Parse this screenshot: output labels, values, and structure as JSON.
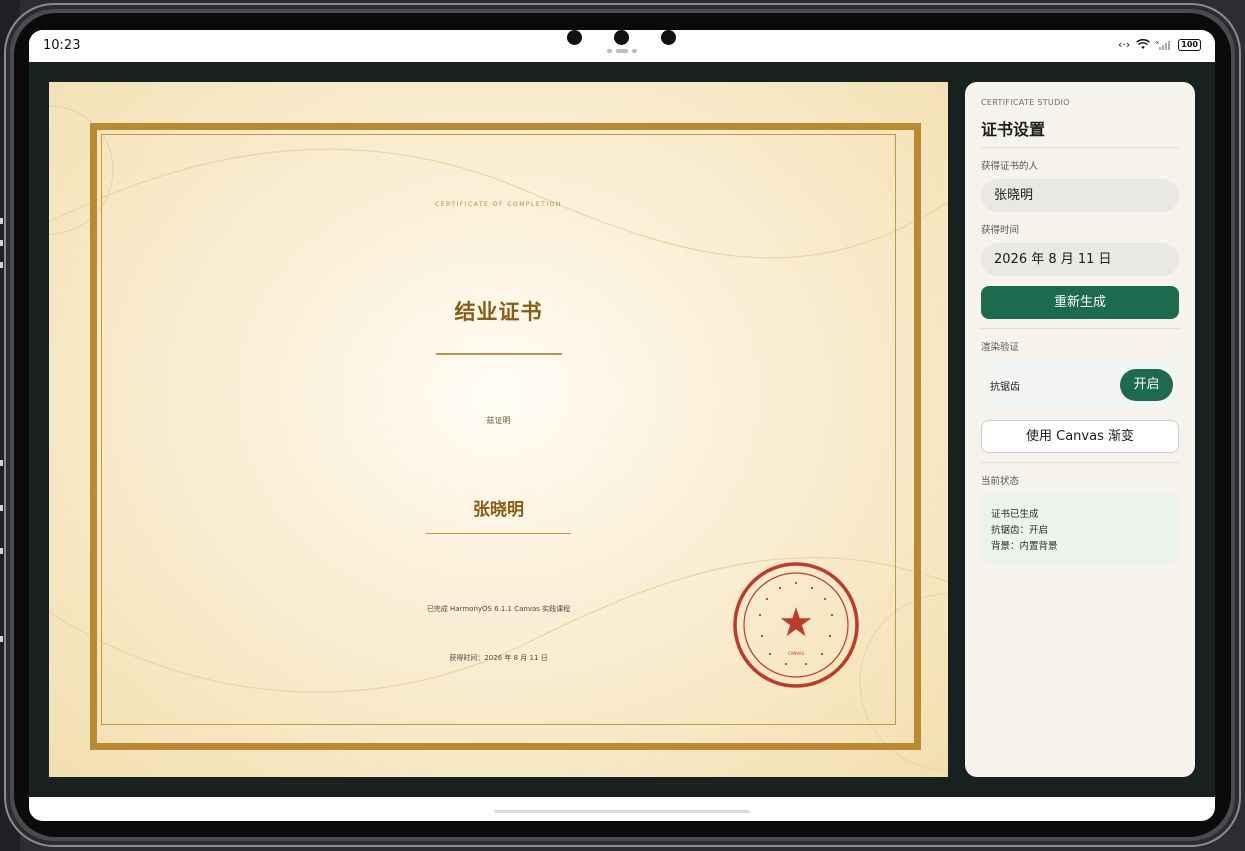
{
  "device": {
    "time": "10:23",
    "battery": "100"
  },
  "certificate": {
    "subtitle": "CERTIFICATE OF COMPLETION",
    "title": "结业证书",
    "presented": "兹证明",
    "name": "张晓明",
    "description": "已完成 HarmonyOS 6.1.1 Canvas 实践课程",
    "date_line": "获得时间：2026 年 8 月 11 日",
    "seal_star": "★",
    "seal_bottom": "CANVAS"
  },
  "panel": {
    "eyebrow": "CERTIFICATE STUDIO",
    "title": "证书设置",
    "recipient_label": "获得证书的人",
    "recipient_value": "张晓明",
    "date_label": "获得时间",
    "date_value": "2026 年 8 月 11 日",
    "regenerate_button": "重新生成",
    "render_section": "渲染验证",
    "antialias_label": "抗锯齿",
    "antialias_toggle": "开启",
    "canvas_gradient_button": "使用 Canvas 渐变",
    "status_section": "当前状态",
    "status_lines": [
      "证书已生成",
      "抗锯齿：开启",
      "背景：内置背景"
    ]
  },
  "colors": {
    "gold": "#b98a33",
    "title_brown": "#8a5b12",
    "seal_red": "#c0392b",
    "primary_green": "#1d6b4e",
    "app_background": "#172220"
  }
}
